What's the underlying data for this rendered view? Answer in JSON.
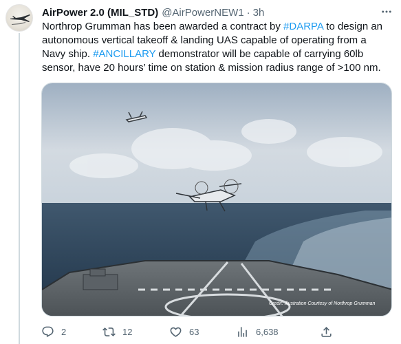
{
  "tweet": {
    "author_name": "AirPower 2.0 (MIL_STD)",
    "handle": "@AirPowerNEW1",
    "separator": "·",
    "time": "3h",
    "lines": [
      {
        "segments": [
          {
            "text": "Northrop Grumman has been awarded a contract by ",
            "tag": false
          },
          {
            "text": "#DARPA",
            "tag": true
          },
          {
            "text": " to design an",
            "tag": false
          }
        ]
      },
      {
        "segments": [
          {
            "text": "autonomous vertical takeoff & landing UAS capable of operating from a",
            "tag": false
          }
        ]
      },
      {
        "segments": [
          {
            "text": "Navy ship. ",
            "tag": false
          },
          {
            "text": "#ANCILLARY",
            "tag": true
          },
          {
            "text": " demonstrator will be capable of carrying  60lb",
            "tag": false
          }
        ]
      },
      {
        "segments": [
          {
            "text": "sensor, have 20 hours’ time on station & mission radius range of >100 nm.",
            "tag": false
          }
        ]
      }
    ],
    "media": {
      "credit": "Credit: Illustration Courtesy of Northrop Grumman"
    },
    "actions": {
      "replies": "2",
      "retweets": "12",
      "likes": "63",
      "views": "6,638"
    },
    "icons": {
      "more": "more-icon",
      "reply": "reply-icon",
      "retweet": "retweet-icon",
      "like": "like-icon",
      "views": "views-icon",
      "share": "share-icon"
    },
    "colors": {
      "link": "#1d9bf0",
      "secondary": "#536471",
      "text": "#0f1419"
    }
  }
}
